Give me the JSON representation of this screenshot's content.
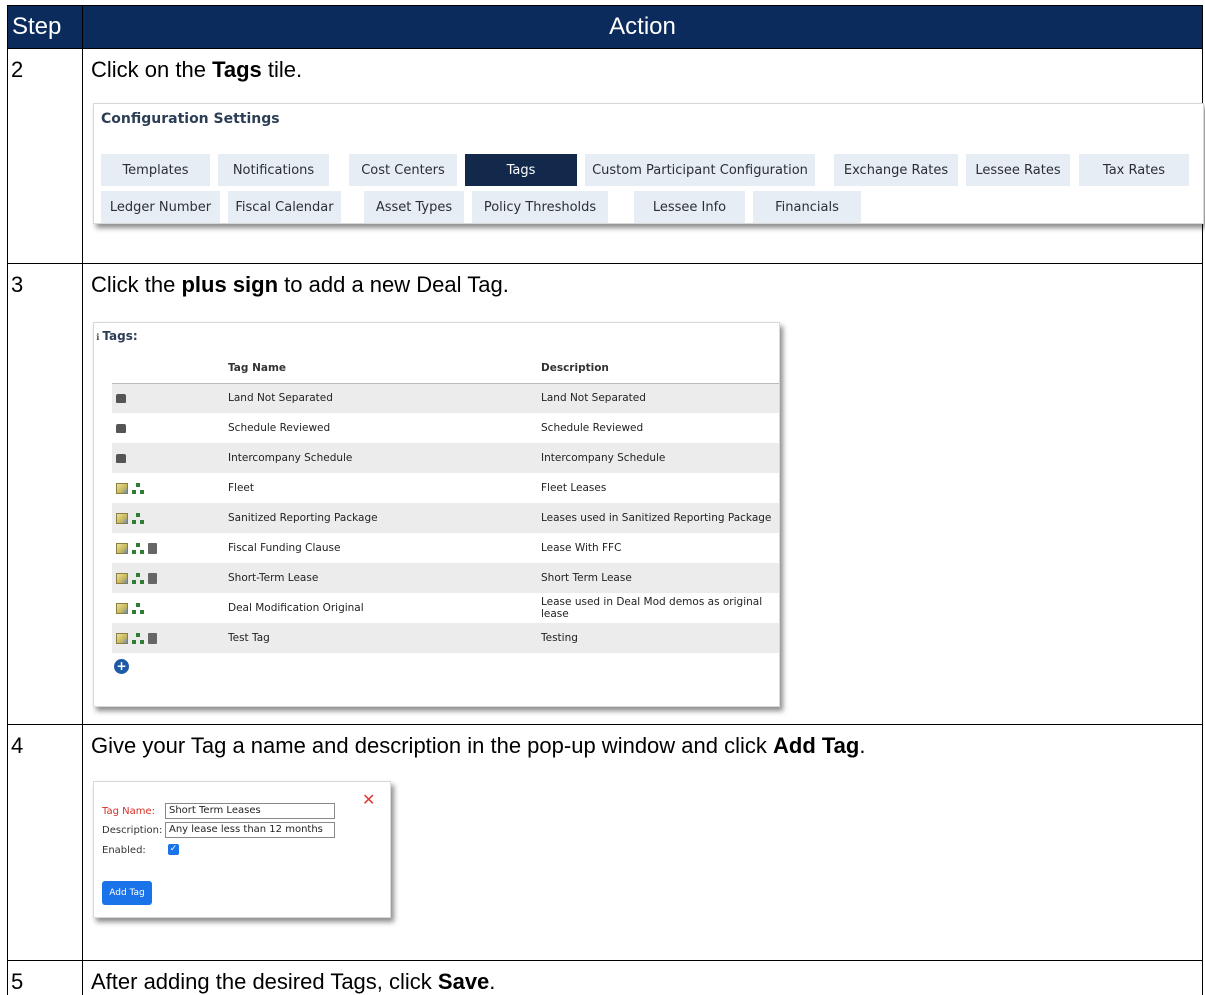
{
  "header": {
    "step": "Step",
    "action": "Action"
  },
  "steps": [
    {
      "num": "2",
      "pre": "Click on the ",
      "bold": "Tags",
      "post": " tile."
    },
    {
      "num": "3",
      "pre": "Click the ",
      "bold": "plus sign",
      "post": " to add a new Deal Tag."
    },
    {
      "num": "4",
      "pre": "Give your Tag a name and description in the pop-up window and click ",
      "bold": "Add Tag",
      "post": "."
    },
    {
      "num": "5",
      "pre": "After adding the desired Tags, click ",
      "bold": "Save",
      "post": "."
    }
  ],
  "config": {
    "title": "Configuration Settings",
    "tiles_row1": [
      "Templates",
      "Notifications",
      "Cost Centers",
      "Tags",
      "Custom Participant Configuration",
      "Exchange Rates",
      "Lessee Rates",
      "Tax Rates"
    ],
    "tiles_row2": [
      "Ledger Number",
      "Fiscal Calendar",
      "Asset Types",
      "Policy Thresholds",
      "Lessee Info",
      "Financials"
    ],
    "active_tile": "Tags"
  },
  "tags": {
    "title": "Tags:",
    "col_name": "Tag Name",
    "col_desc": "Description",
    "rows": [
      {
        "icons": [
          "lock-icon"
        ],
        "name": "Land Not Separated",
        "desc": "Land Not Separated"
      },
      {
        "icons": [
          "lock-icon"
        ],
        "name": "Schedule Reviewed",
        "desc": "Schedule Reviewed"
      },
      {
        "icons": [
          "lock-icon"
        ],
        "name": "Intercompany Schedule",
        "desc": "Intercompany Schedule"
      },
      {
        "icons": [
          "edit-icon",
          "hierarchy-icon"
        ],
        "name": "Fleet",
        "desc": "Fleet Leases"
      },
      {
        "icons": [
          "edit-icon",
          "hierarchy-icon"
        ],
        "name": "Sanitized Reporting Package",
        "desc": "Leases used in Sanitized Reporting Package"
      },
      {
        "icons": [
          "edit-icon",
          "hierarchy-icon",
          "trash-icon"
        ],
        "name": "Fiscal Funding Clause",
        "desc": "Lease With FFC"
      },
      {
        "icons": [
          "edit-icon",
          "hierarchy-icon",
          "trash-icon"
        ],
        "name": "Short-Term Lease",
        "desc": "Short Term Lease"
      },
      {
        "icons": [
          "edit-icon",
          "hierarchy-icon"
        ],
        "name": "Deal Modification Original",
        "desc": "Lease used in Deal Mod demos as original lease"
      },
      {
        "icons": [
          "edit-icon",
          "hierarchy-icon",
          "trash-icon"
        ],
        "name": "Test Tag",
        "desc": "Testing"
      }
    ]
  },
  "popup": {
    "name_label": "Tag Name:",
    "name_value": "Short Term Leases",
    "desc_label": "Description:",
    "desc_value": "Any lease less than 12 months",
    "enabled_label": "Enabled:",
    "enabled": true,
    "button": "Add Tag"
  }
}
